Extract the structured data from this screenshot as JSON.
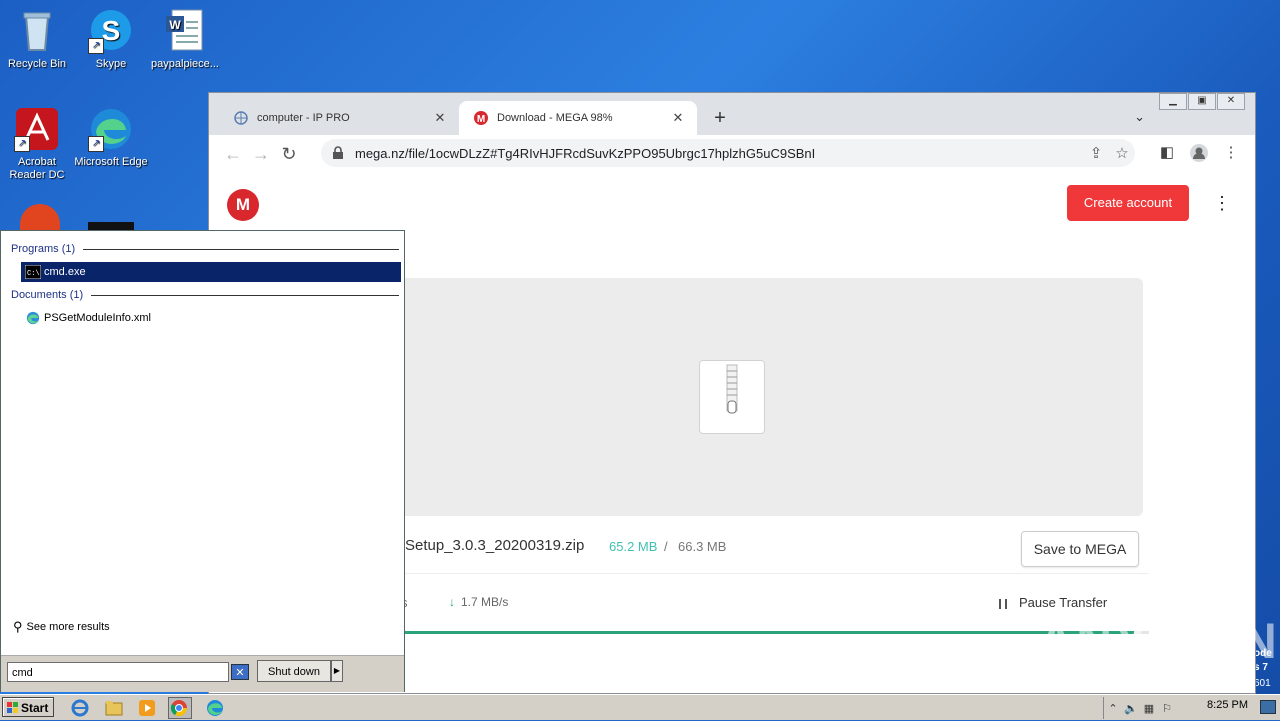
{
  "desktop": {
    "icons": [
      {
        "label": "Recycle Bin",
        "icon": "recycle-bin-icon"
      },
      {
        "label": "Skype",
        "icon": "skype-icon"
      },
      {
        "label": "paypalpiece...",
        "icon": "word-document-icon"
      },
      {
        "label": "Acrobat Reader DC",
        "icon": "acrobat-icon"
      },
      {
        "label": "Microsoft Edge",
        "icon": "edge-icon"
      }
    ],
    "edge_text": [
      "ode",
      "s 7",
      "601"
    ]
  },
  "browser": {
    "tabs": [
      {
        "title": "computer - IP PRO",
        "active": false
      },
      {
        "title": "Download - MEGA 98%",
        "active": true
      }
    ],
    "url": "mega.nz/file/1ocwDLzZ#Tg4RIvHJFRcdSuvKzPPO95Ubrgc17hplzhG5uC9SBnI",
    "page": {
      "logo": "M",
      "create_account": "Create account",
      "file_name": "Setup_3.0.3_20200319.zip",
      "size_done": "65.2 MB",
      "size_sep": "/",
      "size_total": "66.3 MB",
      "save_button": "Save to MEGA",
      "time_left": "s",
      "speed": "1.7 MB/s",
      "pause_label": "Pause Transfer",
      "progress": 0.98,
      "accent": "#f0373a",
      "progress_color": "#2ba47a"
    }
  },
  "startmenu": {
    "programs_header": "Programs (1)",
    "program_item": "cmd.exe",
    "documents_header": "Documents (1)",
    "document_item": "PSGetModuleInfo.xml",
    "see_more": "See more results",
    "search_value": "cmd",
    "shutdown_label": "Shut down"
  },
  "taskbar": {
    "start_label": "Start",
    "clock": "8:25 PM"
  },
  "watermark": "ANY RUN"
}
